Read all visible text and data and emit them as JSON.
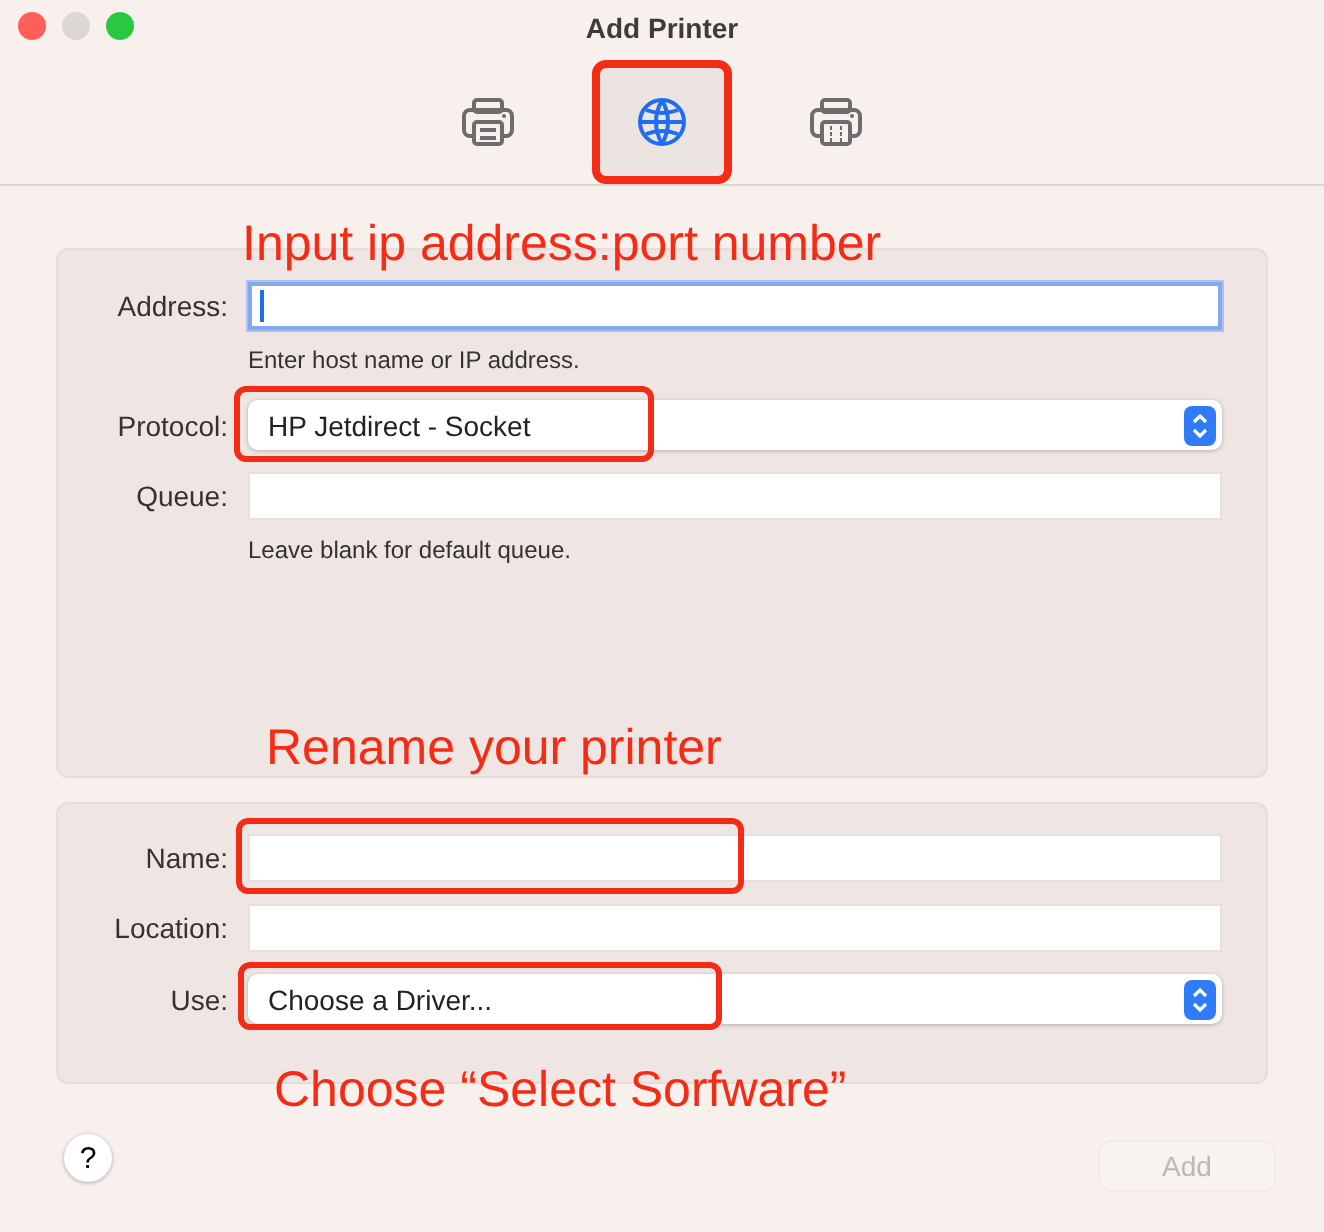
{
  "window": {
    "title": "Add Printer"
  },
  "toolbar": [
    {
      "kind": "printer",
      "selected": false,
      "highlighted": false
    },
    {
      "kind": "globe",
      "selected": true,
      "highlighted": true
    },
    {
      "kind": "printer-grid",
      "selected": false,
      "highlighted": false
    }
  ],
  "connection": {
    "fields": [
      {
        "label": "Address:",
        "kind": "text",
        "focused": true,
        "highlighted": false,
        "hint": "Enter host name or IP address."
      },
      {
        "label": "Protocol:",
        "kind": "popup",
        "value": "HP Jetdirect - Socket",
        "highlighted": true
      },
      {
        "label": "Queue:",
        "kind": "text",
        "focused": false,
        "highlighted": false,
        "hint": "Leave blank for default queue."
      }
    ]
  },
  "details": {
    "fields": [
      {
        "label": "Name:",
        "kind": "text",
        "focused": false,
        "highlighted": true
      },
      {
        "label": "Location:",
        "kind": "text",
        "focused": false,
        "highlighted": false
      },
      {
        "label": "Use:",
        "kind": "popup",
        "value": "Choose a Driver...",
        "highlighted": true
      }
    ]
  },
  "help_button": "?",
  "add_button": {
    "label": "Add",
    "disabled": true
  },
  "annotations": [
    "Input ip address:port number",
    "Rename your printer",
    "Choose “Select Sorfware”"
  ]
}
